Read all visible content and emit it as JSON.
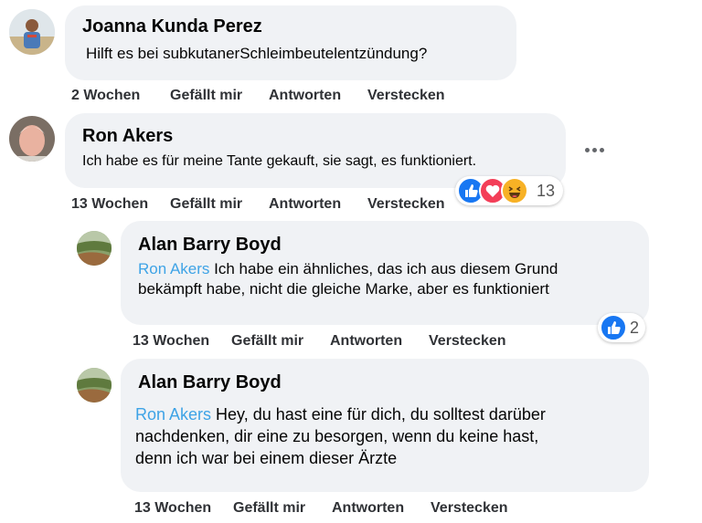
{
  "comments": [
    {
      "author": "Joanna Kunda Perez",
      "text": "Hilft es bei subkutanerSchleimbeutelentzündung?",
      "time": "2 Wochen",
      "like": "Gefällt mir",
      "reply": "Antworten",
      "hide": "Verstecken"
    },
    {
      "author": "Ron Akers",
      "text": "Ich habe es für meine Tante gekauft, sie sagt, es funktioniert.",
      "time": "13 Wochen",
      "like": "Gefällt mir",
      "reply": "Antworten",
      "hide": "Verstecken",
      "reaction_count": "13",
      "reaction_icons": [
        "like-icon",
        "love-icon",
        "haha-icon"
      ],
      "more_icon": "more-options-icon"
    }
  ],
  "replies": [
    {
      "author": "Alan Barry Boyd",
      "mention": "Ron Akers",
      "text_line1": " Ich habe ein ähnliches, das ich aus diesem Grund",
      "text_line2": "bekämpft habe, nicht die gleiche Marke, aber es funktioniert",
      "time": "13 Wochen",
      "like": "Gefällt mir",
      "reply": "Antworten",
      "hide": "Verstecken",
      "reaction_count": "2",
      "reaction_icons": [
        "like-icon"
      ]
    },
    {
      "author": "Alan Barry Boyd",
      "mention": "Ron Akers",
      "text_line1": " Hey, du hast eine für dich, du solltest darüber",
      "text_line2": "nachdenken, dir eine zu besorgen, wenn du keine hast,",
      "text_line3": "denn ich war bei einem dieser Ärzte",
      "time": "13 Wochen",
      "like": "Gefällt mir",
      "reply": "Antworten",
      "hide": "Verstecken"
    }
  ],
  "colors": {
    "bubble": "#f0f2f5",
    "mention": "#3ea3e6",
    "like_blue": "#1877f2",
    "love_red": "#f33e58",
    "haha_yellow": "#f7b125"
  }
}
